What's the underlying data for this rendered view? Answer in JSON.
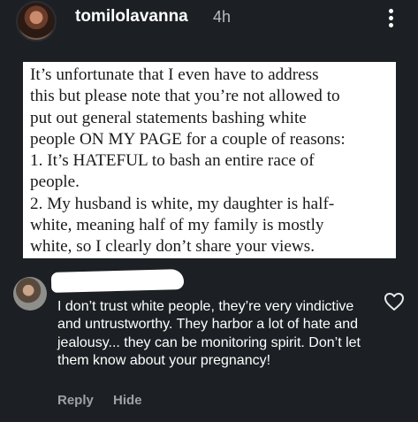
{
  "header": {
    "username": "tomilolavanna",
    "time_ago": "4h",
    "more_icon": "more-vertical-icon"
  },
  "statement": {
    "text": "It’s unfortunate that I even have to address\nthis but please note that you’re not allowed to\nput out general statements bashing white\npeople ON MY PAGE for a couple of reasons:\n1. It’s HATEFUL to bash an entire race of\npeople.\n2. My husband is white, my daughter is half-\nwhite, meaning half of my family is mostly\nwhite, so I clearly don’t share your views."
  },
  "comment": {
    "text": "I don’t trust white people, they’re very vindictive and untrustworthy. They harbor a lot of hate and jealousy... they can be monitoring spirit. Don’t let them know about your pregnancy!",
    "like_icon": "heart-outline-icon",
    "reply_label": "Reply",
    "hide_label": "Hide"
  },
  "colors": {
    "background": "#1c2024",
    "card_background": "#ffffff",
    "secondary_text": "#9ea2a6"
  }
}
